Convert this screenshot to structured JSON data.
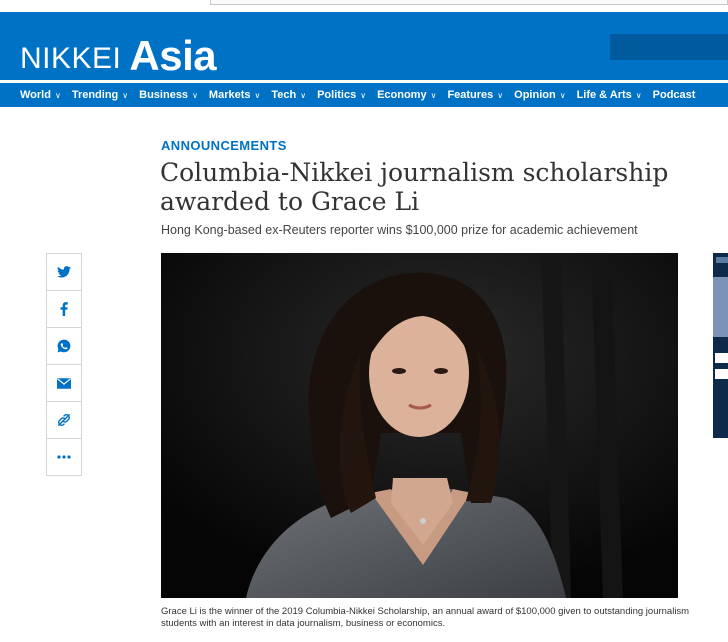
{
  "brand": {
    "logo_left": "NIKKEI",
    "logo_right": "Asia",
    "color": "#0072c6"
  },
  "nav": [
    {
      "label": "World",
      "dropdown": true
    },
    {
      "label": "Trending",
      "dropdown": true
    },
    {
      "label": "Business",
      "dropdown": true
    },
    {
      "label": "Markets",
      "dropdown": true
    },
    {
      "label": "Tech",
      "dropdown": true
    },
    {
      "label": "Politics",
      "dropdown": true
    },
    {
      "label": "Economy",
      "dropdown": true
    },
    {
      "label": "Features",
      "dropdown": true
    },
    {
      "label": "Opinion",
      "dropdown": true
    },
    {
      "label": "Life & Arts",
      "dropdown": true
    },
    {
      "label": "Podcast",
      "dropdown": false
    }
  ],
  "article": {
    "kicker": "ANNOUNCEMENTS",
    "headline": "Columbia-Nikkei journalism scholarship awarded to Grace Li",
    "subhead": "Hong Kong-based ex-Reuters reporter wins $100,000 prize for academic achievement",
    "caption": "Grace Li is the winner of the 2019 Columbia-Nikkei Scholarship, an annual award of $100,000 given to outstanding journalism students with an interest in data journalism, business or economics."
  },
  "share": [
    {
      "icon": "twitter-icon"
    },
    {
      "icon": "facebook-icon"
    },
    {
      "icon": "whatsapp-icon"
    },
    {
      "icon": "email-icon"
    },
    {
      "icon": "link-icon"
    },
    {
      "icon": "more-icon"
    }
  ]
}
